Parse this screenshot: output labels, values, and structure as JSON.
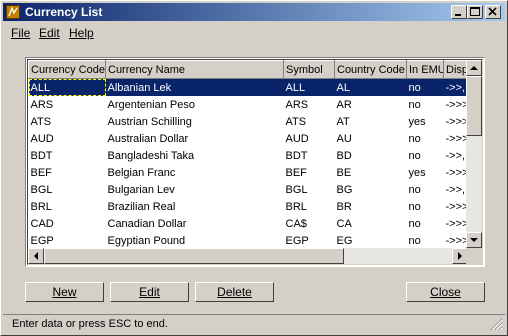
{
  "window": {
    "title": "Currency List"
  },
  "menu": {
    "file": "File",
    "edit": "Edit",
    "help": "Help"
  },
  "grid": {
    "columns": [
      "Currency Code",
      "Currency Name",
      "Symbol",
      "Country Code",
      "In EMU",
      "Displa"
    ],
    "rows": [
      [
        "ALL",
        "Albanian Lek",
        "ALL",
        "AL",
        "no",
        "->>,"
      ],
      [
        "ARS",
        "Argentenian Peso",
        "ARS",
        "AR",
        "no",
        "->>>"
      ],
      [
        "ATS",
        "Austrian Schilling",
        "ATS",
        "AT",
        "yes",
        "->>>"
      ],
      [
        "AUD",
        "Australian Dollar",
        "AUD",
        "AU",
        "no",
        "->>>"
      ],
      [
        "BDT",
        "Bangladeshi Taka",
        "BDT",
        "BD",
        "no",
        "->>,"
      ],
      [
        "BEF",
        "Belgian Franc",
        "BEF",
        "BE",
        "yes",
        "->>>"
      ],
      [
        "BGL",
        "Bulgarian Lev",
        "BGL",
        "BG",
        "no",
        "->>,"
      ],
      [
        "BRL",
        "Brazilian Real",
        "BRL",
        "BR",
        "no",
        "->>>"
      ],
      [
        "CAD",
        "Canadian Dollar",
        "CA$",
        "CA",
        "no",
        "->>>"
      ],
      [
        "EGP",
        "Egyptian Pound",
        "EGP",
        "EG",
        "no",
        "->>>"
      ]
    ],
    "selected_row": 0
  },
  "buttons": {
    "new": "New",
    "edit": "Edit",
    "delete": "Delete",
    "close": "Close"
  },
  "status": {
    "text": "Enter data or press ESC to end."
  },
  "colors": {
    "title_start": "#0a246a",
    "title_end": "#a6caf0",
    "selection": "#0a246a",
    "face": "#d4d0c8"
  },
  "icons": {
    "app": "currency-app-icon",
    "minimize": "minimize-icon",
    "maximize": "maximize-icon",
    "close": "close-icon"
  }
}
